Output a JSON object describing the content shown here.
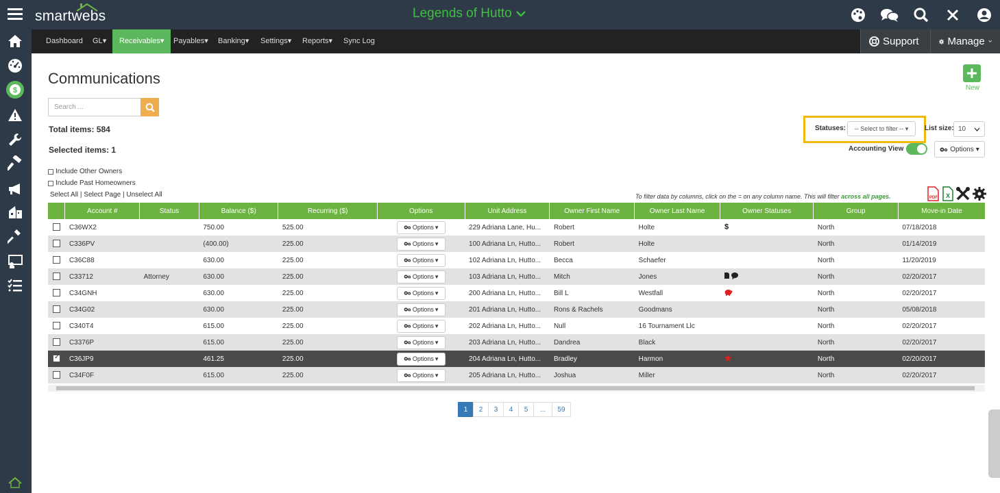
{
  "app": {
    "logo_text": "smartwebs",
    "association": "Legends of Hutto"
  },
  "sidebar": {
    "items": [
      {
        "name": "home-icon"
      },
      {
        "name": "dashboard-icon"
      },
      {
        "name": "dollar-icon"
      },
      {
        "name": "warning-icon"
      },
      {
        "name": "wrench-icon"
      },
      {
        "name": "hammer-icon"
      },
      {
        "name": "megaphone-icon"
      },
      {
        "name": "buildings-icon"
      },
      {
        "name": "gavel-icon"
      },
      {
        "name": "presentation-icon"
      },
      {
        "name": "tasks-icon"
      }
    ]
  },
  "nav": {
    "items": [
      "Dashboard",
      "GL",
      "Receivables",
      "Payables",
      "Banking",
      "Settings",
      "Reports",
      "Sync Log"
    ],
    "support": "Support",
    "manage": "Manage"
  },
  "page": {
    "title": "Communications",
    "new_label": "New",
    "search_placeholder": "Search ...",
    "total_items": "Total items: 584",
    "selected_items": "Selected items: 1",
    "include_other_owners": "Include Other Owners",
    "include_past_homeowners": "Include Past Homeowners",
    "select_all": "Select All",
    "select_page": "Select Page",
    "unselect_all": "Unselect All",
    "statuses_label": "Statuses:",
    "statuses_placeholder": "-- Select to filter --",
    "list_size_label": "List size:",
    "list_size_value": "10",
    "accounting_view": "Accounting View",
    "options_label": "Options",
    "filter_hint": "To filter data by columns, click on the = on any column name. This will filter",
    "filter_hint_emphasis": "across all pages."
  },
  "table": {
    "columns": [
      "Account #",
      "Status",
      "Balance ($)",
      "Recurring ($)",
      "Options",
      "Unit Address",
      "Owner First Name",
      "Owner Last Name",
      "Owner Statuses",
      "Group",
      "Move-in Date"
    ],
    "option_button": "Options",
    "rows": [
      {
        "account": "C36WX2",
        "status": "",
        "balance": "750.00",
        "recurring": "525.00",
        "address": "229 Adriana Lane, Hu...",
        "first": "Robert",
        "last": "Holte",
        "group": "North",
        "movein": "07/18/2018",
        "checked": false,
        "owner_status": "dollar"
      },
      {
        "account": "C336PV",
        "status": "",
        "balance": "(400.00)",
        "recurring": "225.00",
        "address": "100 Adriana Ln, Hutto...",
        "first": "Robert",
        "last": "Holte",
        "group": "North",
        "movein": "01/14/2019",
        "checked": false,
        "owner_status": ""
      },
      {
        "account": "C36C88",
        "status": "",
        "balance": "630.00",
        "recurring": "225.00",
        "address": "102 Adriana Ln, Hutto...",
        "first": "Becca",
        "last": "Schaefer",
        "group": "North",
        "movein": "11/20/2019",
        "checked": false,
        "owner_status": ""
      },
      {
        "account": "C33712",
        "status": "Attorney",
        "balance": "630.00",
        "recurring": "225.00",
        "address": "103 Adriana Ln, Hutto...",
        "first": "Mitch",
        "last": "Jones",
        "group": "North",
        "movein": "02/20/2017",
        "checked": false,
        "owner_status": "doc-chat"
      },
      {
        "account": "C34GNH",
        "status": "",
        "balance": "630.00",
        "recurring": "225.00",
        "address": "200 Adriana Ln, Hutto...",
        "first": "Bill L",
        "last": "Westfall",
        "group": "North",
        "movein": "02/20/2017",
        "checked": false,
        "owner_status": "piggy"
      },
      {
        "account": "C34G02",
        "status": "",
        "balance": "630.00",
        "recurring": "225.00",
        "address": "201 Adriana Ln, Hutto...",
        "first": "Rons & Rachels",
        "last": "Goodmans",
        "group": "North",
        "movein": "05/08/2018",
        "checked": false,
        "owner_status": ""
      },
      {
        "account": "C340T4",
        "status": "",
        "balance": "615.00",
        "recurring": "225.00",
        "address": "202 Adriana Ln, Hutto...",
        "first": "Null",
        "last": "16 Tournament Llc",
        "group": "North",
        "movein": "02/20/2017",
        "checked": false,
        "owner_status": ""
      },
      {
        "account": "C3376P",
        "status": "",
        "balance": "615.00",
        "recurring": "225.00",
        "address": "203 Adriana Ln, Hutto...",
        "first": "Dandrea",
        "last": "Black",
        "group": "North",
        "movein": "02/20/2017",
        "checked": false,
        "owner_status": ""
      },
      {
        "account": "C36JP9",
        "status": "",
        "balance": "461.25",
        "recurring": "225.00",
        "address": "204 Adriana Ln, Hutto...",
        "first": "Bradley",
        "last": "Harmon",
        "group": "North",
        "movein": "02/20/2017",
        "checked": true,
        "owner_status": "star"
      },
      {
        "account": "C34F0F",
        "status": "",
        "balance": "615.00",
        "recurring": "225.00",
        "address": "205 Adriana Ln, Hutto...",
        "first": "Joshua",
        "last": "Miller",
        "group": "North",
        "movein": "02/20/2017",
        "checked": false,
        "owner_status": ""
      }
    ]
  },
  "pagination": {
    "pages": [
      "1",
      "2",
      "3",
      "4",
      "5",
      "...",
      "59"
    ],
    "current": "1"
  },
  "colors": {
    "accent_green": "#5cb85c",
    "header_green": "#6cb342",
    "sidebar_bg": "#2e3a47",
    "highlight_yellow": "#f0b90b",
    "search_orange": "#f0ad4e"
  }
}
